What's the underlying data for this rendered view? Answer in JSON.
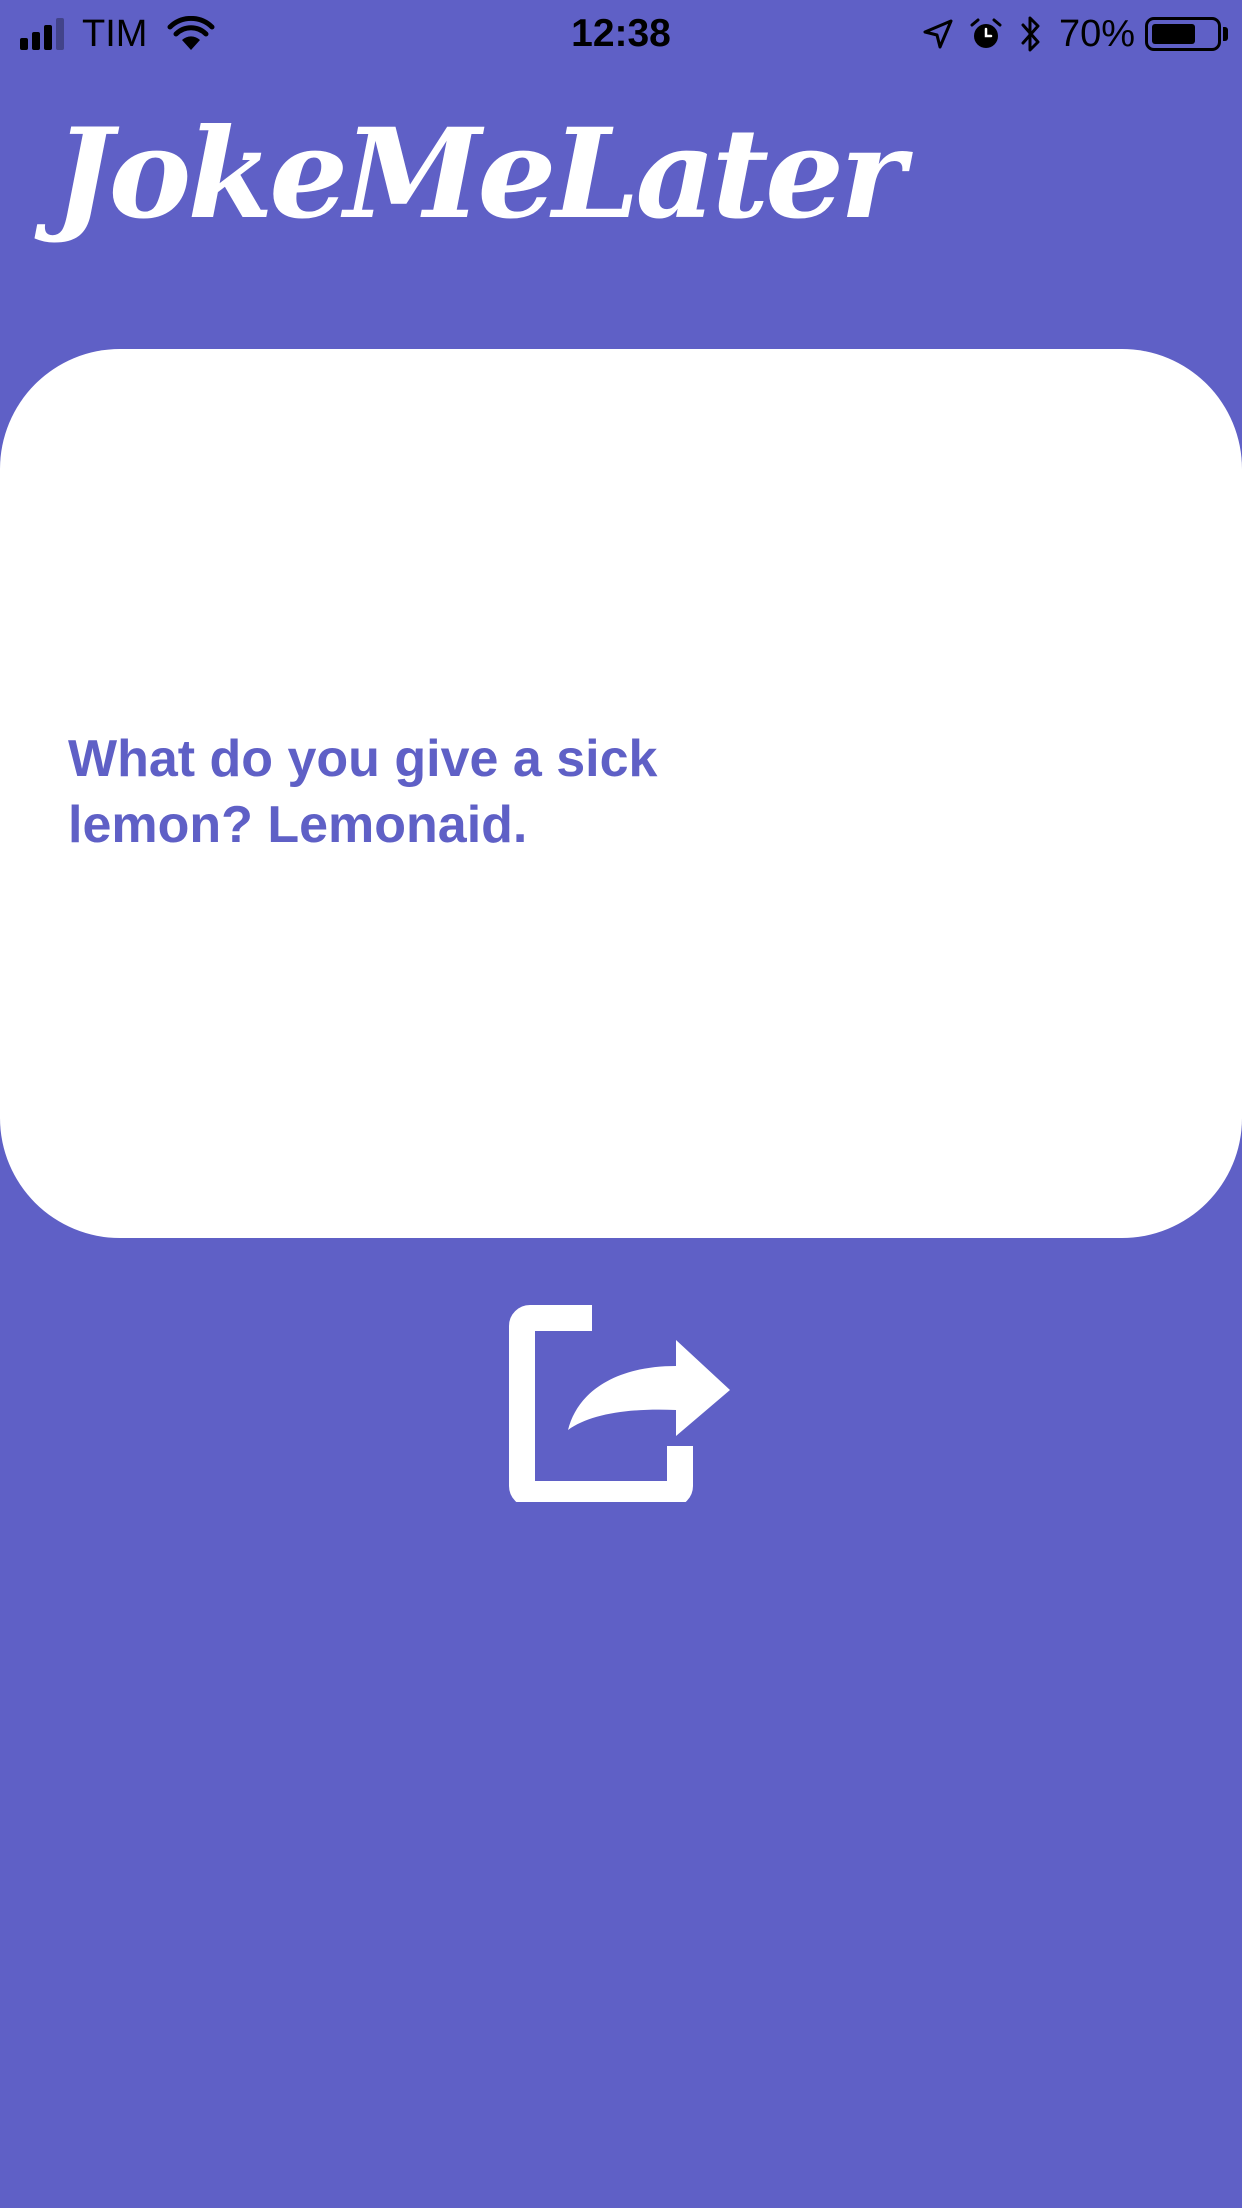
{
  "status_bar": {
    "carrier": "TIM",
    "time": "12:38",
    "battery_percent": "70%",
    "battery_level": 0.7,
    "signal_bars": 3,
    "signal_bars_total": 4,
    "icons": [
      "signal-icon",
      "wifi-icon",
      "location-arrow-icon",
      "alarm-icon",
      "bluetooth-icon",
      "battery-icon"
    ]
  },
  "header": {
    "app_title": "JokeMeLater"
  },
  "joke_card": {
    "text": "What do you give a sick lemon? Lemonaid."
  },
  "share": {
    "icon": "share-icon"
  },
  "colors": {
    "background": "#5f60c6",
    "card": "#ffffff",
    "joke_text": "#5f60c6",
    "title": "#ffffff"
  }
}
